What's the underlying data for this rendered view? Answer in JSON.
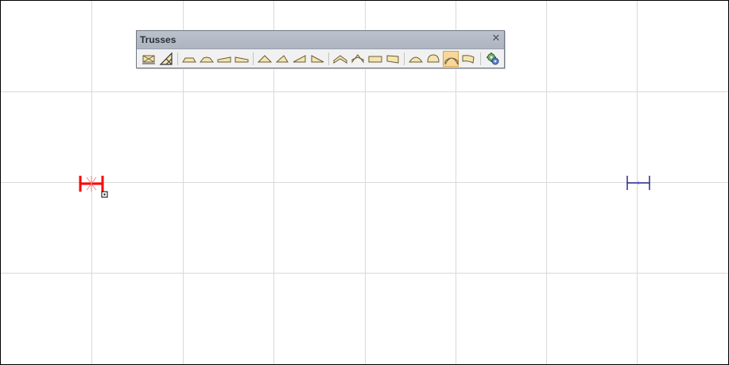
{
  "palette": {
    "title": "Trusses",
    "close_glyph": "✕",
    "buttons": [
      {
        "icon": "floor-truss-icon"
      },
      {
        "icon": "roof-truss-icon"
      },
      {
        "icon": "pitched-bottom-flat-icon"
      },
      {
        "icon": "flat-top-pitched-bottom-icon"
      },
      {
        "icon": "pitched-left-single-icon"
      },
      {
        "icon": "pitched-right-single-icon"
      },
      {
        "icon": "king-post-icon"
      },
      {
        "icon": "mono-triangle-left-icon"
      },
      {
        "icon": "mono-slope-left-icon"
      },
      {
        "icon": "mono-slope-right-icon"
      },
      {
        "icon": "scissor-icon"
      },
      {
        "icon": "inverted-scissor-icon"
      },
      {
        "icon": "flat-parallel-icon"
      },
      {
        "icon": "tapered-parallel-icon"
      },
      {
        "icon": "bowstring-icon"
      },
      {
        "icon": "arched-icon"
      },
      {
        "icon": "curved-scissor-icon"
      },
      {
        "icon": "curved-mono-icon"
      },
      {
        "icon": "gear-settings-icon"
      }
    ],
    "selected_index": 16
  },
  "colors": {
    "grid": "#d9d9d9",
    "truss_fill": "#f3e5b2",
    "truss_stroke": "#6b5c34",
    "point_red": "#ff0000",
    "point_blue": "#2a2a8c"
  },
  "markers": [
    {
      "name": "insertion-point-start",
      "color": "red",
      "active": true
    },
    {
      "name": "insertion-point-end",
      "color": "blue",
      "active": false
    }
  ]
}
